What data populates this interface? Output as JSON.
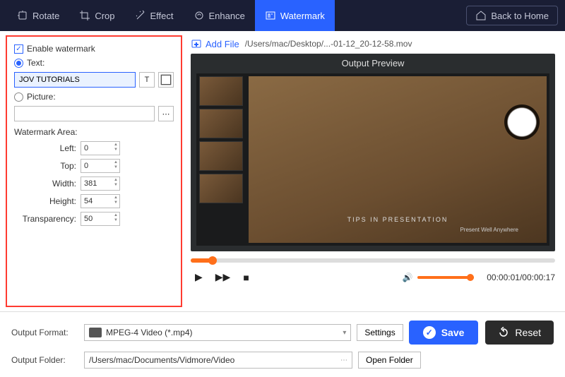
{
  "toolbar": {
    "rotate": "Rotate",
    "crop": "Crop",
    "effect": "Effect",
    "enhance": "Enhance",
    "watermark": "Watermark",
    "back_home": "Back to Home"
  },
  "watermark_panel": {
    "enable_label": "Enable watermark",
    "text_label": "Text:",
    "text_value": "JOV TUTORIALS",
    "picture_label": "Picture:",
    "picture_value": "",
    "area_label": "Watermark Area:",
    "left_label": "Left:",
    "left": "0",
    "top_label": "Top:",
    "top": "0",
    "width_label": "Width:",
    "width": "381",
    "height_label": "Height:",
    "height": "54",
    "transparency_label": "Transparency:",
    "transparency": "50"
  },
  "file_bar": {
    "add_file": "Add File",
    "path": "/Users/mac/Desktop/...-01-12_20-12-58.mov"
  },
  "preview": {
    "title": "Output Preview",
    "slide_caption": "TIPS IN\nPRESENTATION",
    "slide_sub": "Present Well Anywhere"
  },
  "player": {
    "time": "00:00:01/00:00:17"
  },
  "footer": {
    "format_label": "Output Format:",
    "format_value": "MPEG-4 Video (*.mp4)",
    "settings": "Settings",
    "folder_label": "Output Folder:",
    "folder_value": "/Users/mac/Documents/Vidmore/Video",
    "open_folder": "Open Folder",
    "save": "Save",
    "reset": "Reset"
  }
}
